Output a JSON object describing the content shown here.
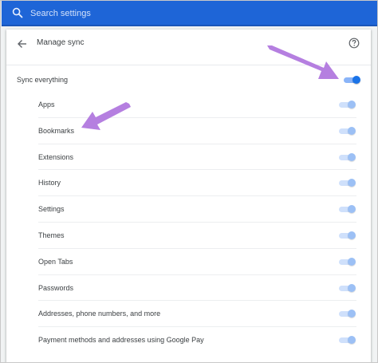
{
  "search": {
    "placeholder": "Search settings"
  },
  "header": {
    "title": "Manage sync"
  },
  "master": {
    "label": "Sync everything",
    "enabled": true
  },
  "items": [
    {
      "label": "Apps",
      "enabled": true
    },
    {
      "label": "Bookmarks",
      "enabled": true
    },
    {
      "label": "Extensions",
      "enabled": true
    },
    {
      "label": "History",
      "enabled": true
    },
    {
      "label": "Settings",
      "enabled": true
    },
    {
      "label": "Themes",
      "enabled": true
    },
    {
      "label": "Open Tabs",
      "enabled": true
    },
    {
      "label": "Passwords",
      "enabled": true
    },
    {
      "label": "Addresses, phone numbers, and more",
      "enabled": true
    },
    {
      "label": "Payment methods and addresses using Google Pay",
      "enabled": true
    }
  ],
  "colors": {
    "header_bg": "#1e65d7",
    "toggle_on": "#1a73e8",
    "annotation_arrow": "#b57fe0"
  },
  "icons": {
    "search": "search-icon",
    "back": "arrow-back-icon",
    "help": "help-circle-icon"
  }
}
